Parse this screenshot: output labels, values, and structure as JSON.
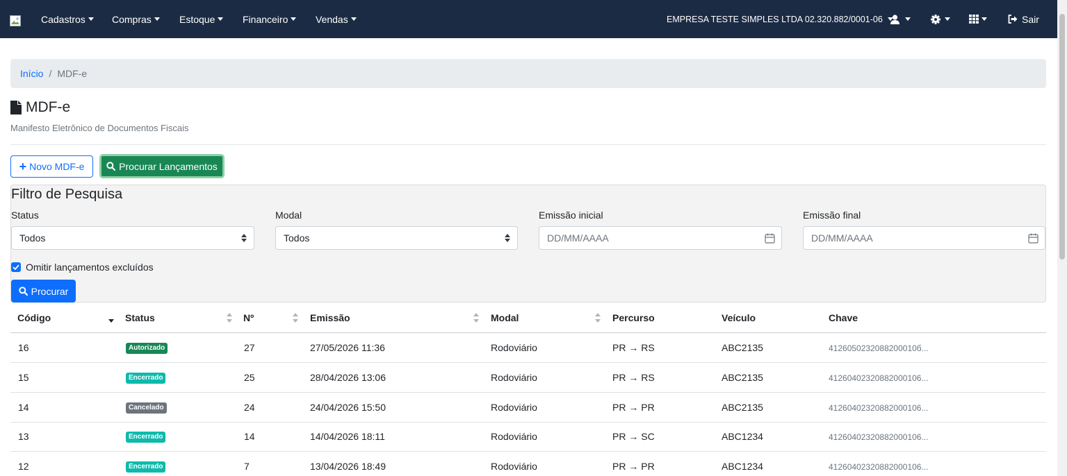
{
  "navbar": {
    "menus": [
      {
        "label": "Cadastros"
      },
      {
        "label": "Compras"
      },
      {
        "label": "Estoque"
      },
      {
        "label": "Financeiro"
      },
      {
        "label": "Vendas"
      }
    ],
    "company": "EMPRESA TESTE SIMPLES LTDA 02.320.882/0001-06",
    "logout_label": "Sair"
  },
  "breadcrumb": {
    "home": "Início",
    "separator": "/",
    "current": "MDF-e"
  },
  "page": {
    "title": "MDF-e",
    "subtitle": "Manifesto Eletrônico de Documentos Fiscais"
  },
  "actions": {
    "new_label": "Novo MDF-e",
    "search_launch_label": "Procurar Lançamentos"
  },
  "filter": {
    "title": "Filtro de Pesquisa",
    "status_label": "Status",
    "status_value": "Todos",
    "modal_label": "Modal",
    "modal_value": "Todos",
    "emissao_inicial_label": "Emissão inicial",
    "emissao_inicial_placeholder": "DD/MM/AAAA",
    "emissao_final_label": "Emissão final",
    "emissao_final_placeholder": "DD/MM/AAAA",
    "omit_deleted_label": "Omitir lançamentos excluídos",
    "omit_deleted_checked": true,
    "search_label": "Procurar"
  },
  "table": {
    "headers": [
      "Código",
      "Status",
      "Nº",
      "Emissão",
      "Modal",
      "Percurso",
      "Veículo",
      "Chave"
    ],
    "rows": [
      {
        "codigo": "16",
        "status": "Autorizado",
        "status_color": "#198754",
        "numero": "27",
        "emissao": "27/05/2026 11:36",
        "modal": "Rodoviário",
        "percurso": "PR → RS",
        "veiculo": "ABC2135",
        "chave": "4126050232088200010б..."
      },
      {
        "codigo": "15",
        "status": "Encerrado",
        "status_color": "#0dbaab",
        "numero": "25",
        "emissao": "28/04/2026 13:06",
        "modal": "Rodoviário",
        "percurso": "PR → RS",
        "veiculo": "ABC2135",
        "chave": "41260402320882000106..."
      },
      {
        "codigo": "14",
        "status": "Cancelado",
        "status_color": "#6c757d",
        "numero": "24",
        "emissao": "24/04/2026 15:50",
        "modal": "Rodoviário",
        "percurso": "PR → PR",
        "veiculo": "ABC2135",
        "chave": "41260402320882000106..."
      },
      {
        "codigo": "13",
        "status": "Encerrado",
        "status_color": "#0dbaab",
        "numero": "14",
        "emissao": "14/04/2026 18:11",
        "modal": "Rodoviário",
        "percurso": "PR → SC",
        "veiculo": "ABC1234",
        "chave": "41260402320882000106..."
      },
      {
        "codigo": "12",
        "status": "Encerrado",
        "status_color": "#0dbaab",
        "numero": "7",
        "emissao": "13/04/2026 18:49",
        "modal": "Rodoviário",
        "percurso": "PR → PR",
        "veiculo": "ABC1234",
        "chave": "41260402320882000106..."
      }
    ]
  },
  "colors": {
    "navbar": "#1c2b44",
    "primary": "#0d6efd",
    "success": "#198754"
  }
}
